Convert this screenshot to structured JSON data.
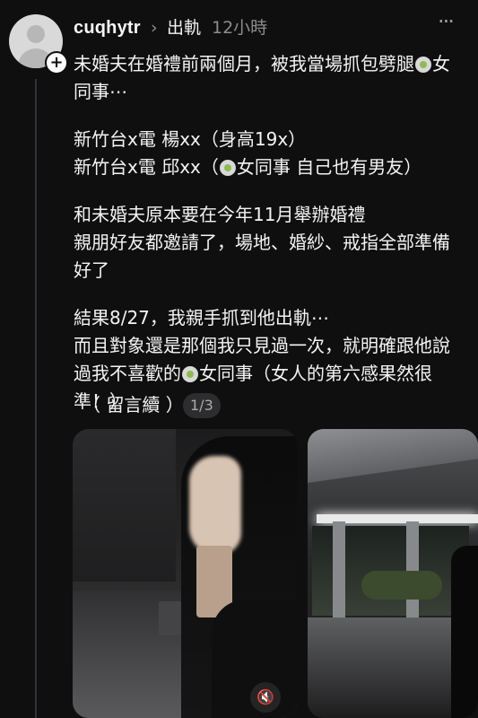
{
  "header": {
    "username": "cuqhytr",
    "chevron": "›",
    "topic": "出軌",
    "time": "12小時",
    "more": "···"
  },
  "post": {
    "lines": [
      "未婚夫在婚禮前兩個月，被我當場抓包劈腿",
      "女",
      "同事⋯",
      "新竹台x電 楊xx（身高19x）",
      "新竹台x電 邱xx（",
      "女同事 自己也有男友）",
      "和未婚夫原本要在今年11月舉辦婚禮",
      "親朋好友都邀請了，場地、婚紗、戒指全部準備",
      "好了",
      "結果8/27，我親手抓到他出軌⋯",
      "而且對象還是那個我只見過一次，就明確跟他說",
      "過我不喜歡的",
      "女同事（女人的第六感果然很",
      "準！）"
    ]
  },
  "reply": {
    "label": "（ 留言續 ）",
    "page_indicator": "1/3"
  },
  "icons": {
    "avatar": "user-avatar",
    "follow": "plus-icon",
    "more": "more-horizontal-icon",
    "mute": "muted-speaker-icon"
  },
  "mute_symbol": "🔇"
}
